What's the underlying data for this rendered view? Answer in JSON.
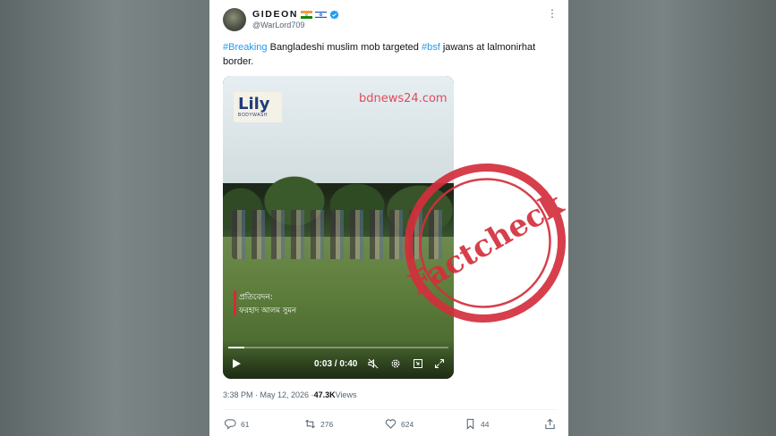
{
  "tweet": {
    "display_name": "GIDEON",
    "handle": "@WarLord709",
    "flag_icons": [
      "india-flag-icon",
      "israel-flag-icon"
    ],
    "verified_icon": "verified-badge-icon",
    "text": {
      "hashtag_1": "#Breaking",
      "segment_1": " Bangladeshi muslim mob targeted ",
      "hashtag_2": "#bsf",
      "segment_2": " jawans at lalmonirhat border."
    },
    "timestamp": "3:38 PM · May 12, 2026 · ",
    "views_count": "47.3K",
    "views_label": " Views"
  },
  "video": {
    "logo_text": "Lily",
    "logo_sub": "BODYWASH",
    "watermark": "bdnews24.com",
    "reporter_label": "প্রতিবেদন:",
    "reporter_name": "ফরহাদ আলম সুমন",
    "time": "0:03 / 0:40",
    "progress": 0.075
  },
  "stamp_text": "Factcheck",
  "actions": {
    "replies": "61",
    "retweets": "276",
    "likes": "624",
    "bookmarks": "44"
  },
  "colors": {
    "link": "#1d9bf0",
    "stamp_red": "#d32f3c",
    "text_primary": "#0f1419",
    "text_secondary": "#536471"
  }
}
